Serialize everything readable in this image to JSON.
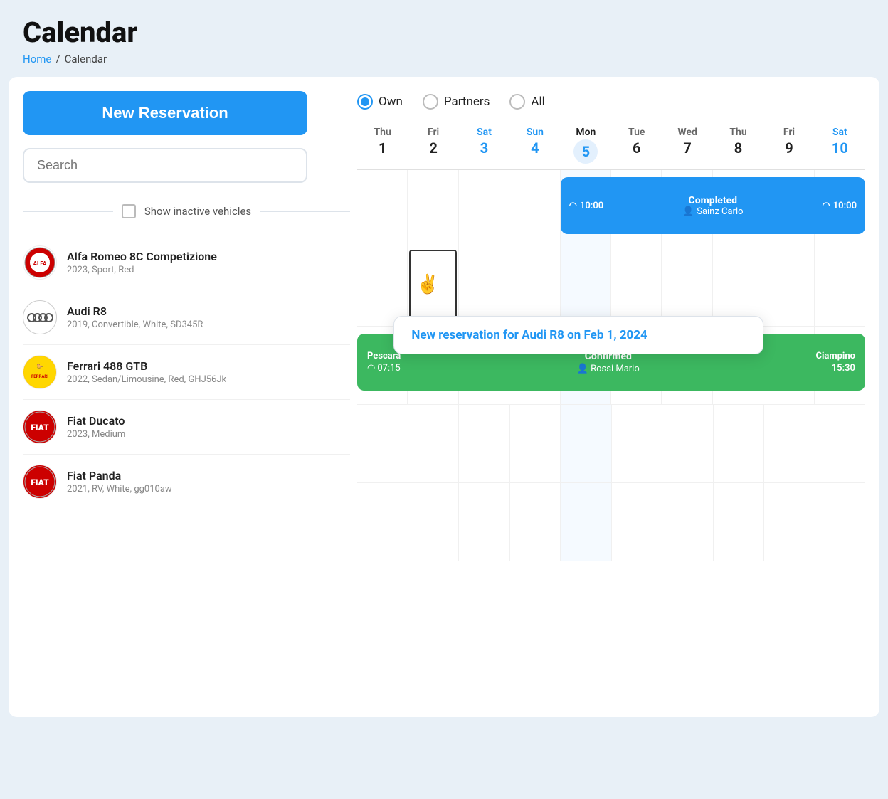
{
  "page": {
    "title": "Calendar",
    "breadcrumb_home": "Home",
    "breadcrumb_current": "Calendar"
  },
  "sidebar": {
    "new_reservation_label": "New Reservation",
    "search_placeholder": "Search",
    "show_inactive_label": "Show inactive vehicles",
    "filter": {
      "own_label": "Own",
      "partners_label": "Partners",
      "all_label": "All",
      "selected": "own"
    },
    "vehicles": [
      {
        "id": "alfa",
        "name": "Alfa Romeo 8C Competizione",
        "details": "2023, Sport, Red",
        "logo_type": "alfa"
      },
      {
        "id": "audi",
        "name": "Audi R8",
        "details": "2019, Convertible, White, SD345R",
        "logo_type": "audi"
      },
      {
        "id": "ferrari",
        "name": "Ferrari 488 GTB",
        "details": "2022, Sedan/Limousine, Red, GHJ56Jk",
        "logo_type": "ferrari"
      },
      {
        "id": "fiat_ducato",
        "name": "Fiat Ducato",
        "details": "2023, Medium",
        "logo_type": "fiat"
      },
      {
        "id": "fiat_panda",
        "name": "Fiat Panda",
        "details": "2021, RV, White, gg010aw",
        "logo_type": "fiat"
      }
    ]
  },
  "calendar": {
    "days": [
      {
        "name": "Thu",
        "num": "1",
        "type": "normal"
      },
      {
        "name": "Fri",
        "num": "2",
        "type": "normal"
      },
      {
        "name": "Sat",
        "num": "3",
        "type": "weekend"
      },
      {
        "name": "Sun",
        "num": "4",
        "type": "weekend"
      },
      {
        "name": "Mon",
        "num": "5",
        "type": "today"
      },
      {
        "name": "Tue",
        "num": "6",
        "type": "normal"
      },
      {
        "name": "Wed",
        "num": "7",
        "type": "normal"
      },
      {
        "name": "Thu",
        "num": "8",
        "type": "normal"
      },
      {
        "name": "Fri",
        "num": "9",
        "type": "normal"
      },
      {
        "name": "Sat",
        "num": "10",
        "type": "weekend"
      }
    ],
    "events": {
      "alfa_row": {
        "type": "blue",
        "status": "Completed",
        "person": "Sainz Carlo",
        "time_start": "10:00",
        "time_end": "10:00",
        "col_start": 4,
        "col_span": 6
      },
      "ferrari_row": {
        "type": "green",
        "location_start": "Pescara",
        "time_start": "07:15",
        "status": "Confirmed",
        "person": "Rossi Mario",
        "location_end": "Ciampino",
        "time_end": "15:30",
        "col_start": 0,
        "col_span": 10
      }
    },
    "tooltip": {
      "text": "New reservation for Audi R8 on Feb 1, 2024"
    }
  }
}
